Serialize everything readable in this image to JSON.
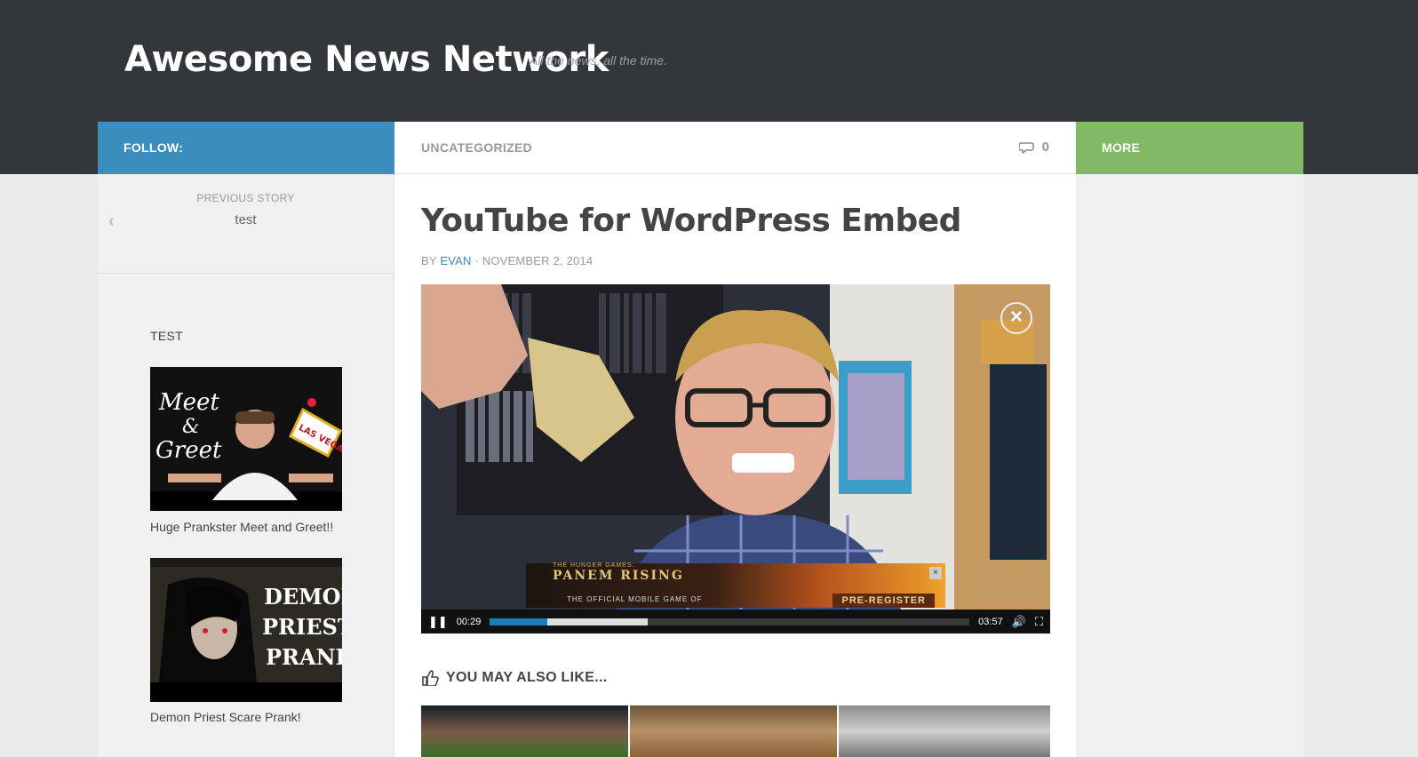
{
  "site": {
    "title": "Awesome News Network",
    "tagline": "All the news, all the time."
  },
  "nav": {
    "follow_label": "FOLLOW:",
    "category": "UNCATEGORIZED",
    "comment_count": "0",
    "more_label": "MORE"
  },
  "sidebar": {
    "prev_label": "PREVIOUS STORY",
    "prev_title": "test",
    "widget_title": "TEST",
    "items": [
      {
        "caption": "Huge Prankster Meet and Greet!!",
        "thumb_text_left": "Meet & Greet",
        "thumb_badge": "LAS VEGAS"
      },
      {
        "caption": "Demon Priest Scare Prank!",
        "thumb_text": "DEMON PRIEST PRANK"
      }
    ]
  },
  "post": {
    "title": "YouTube for WordPress Embed",
    "by": "BY",
    "author": "EVAN",
    "date": "· NOVEMBER 2, 2014"
  },
  "video": {
    "current_time": "00:29",
    "duration": "03:57",
    "played_fraction": 0.12,
    "buffered_fraction": 0.33,
    "ad": {
      "title": "PANEM RISING",
      "pretitle": "THE HUNGER GAMES:",
      "subtitle": "THE OFFICIAL MOBILE GAME OF",
      "cta": "PRE-REGISTER"
    }
  },
  "related": {
    "heading": "YOU MAY ALSO LIKE..."
  },
  "colors": {
    "header_bg": "#33363b",
    "follow_bg": "#3b8dbd",
    "more_bg": "#82b965",
    "accent": "#3b8dbd"
  }
}
